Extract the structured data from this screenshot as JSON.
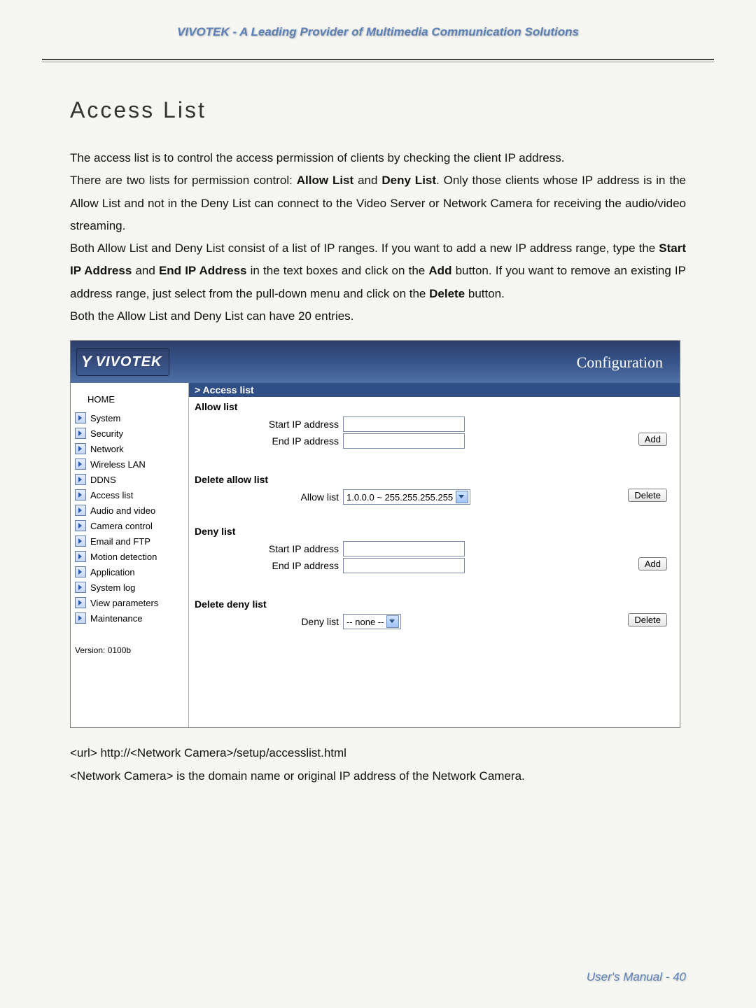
{
  "header": {
    "tagline": "VIVOTEK - A Leading Provider of Multimedia Communication Solutions"
  },
  "title": "Access List",
  "paragraphs": {
    "p1": "The access list is to control the access permission of clients by checking the client IP address.",
    "p2_a": "There are two lists for permission control: ",
    "p2_allow": "Allow List",
    "p2_b": " and ",
    "p2_deny": "Deny List",
    "p2_c": ". Only those clients whose IP address is in the Allow List and not in the Deny List can connect to the Video Server or Network Camera for receiving the audio/video streaming.",
    "p3_a": "Both Allow List and Deny List consist of a list of IP ranges. If you want to add a new IP address range, type the ",
    "p3_start": "Start IP Address",
    "p3_b": " and ",
    "p3_end": "End IP Address",
    "p3_c": " in the text boxes and click on the ",
    "p3_add": "Add",
    "p3_d": " button. If you want to remove an existing IP address range, just select from the pull-down menu and click on the ",
    "p3_del": "Delete",
    "p3_e": " button.",
    "p4": "Both the Allow List and Deny List can have 20 entries."
  },
  "screenshot": {
    "logo_text": "VIVOTEK",
    "config": "Configuration",
    "nav_home": "HOME",
    "nav_items": [
      "System",
      "Security",
      "Network",
      "Wireless LAN",
      "DDNS",
      "Access list",
      "Audio and video",
      "Camera control",
      "Email and FTP",
      "Motion detection",
      "Application",
      "System log",
      "View parameters",
      "Maintenance"
    ],
    "version": "Version: 0100b",
    "crumb": "> Access list",
    "allow_title": "Allow list",
    "start_ip": "Start IP address",
    "end_ip": "End IP address",
    "add": "Add",
    "del_allow_title": "Delete allow list",
    "allow_sel_label": "Allow list",
    "allow_sel_value": "1.0.0.0 ~ 255.255.255.255",
    "delete": "Delete",
    "deny_title": "Deny list",
    "del_deny_title": "Delete deny list",
    "deny_sel_label": "Deny list",
    "deny_sel_value": "-- none --"
  },
  "after": {
    "line1": "<url> http://<Network Camera>/setup/accesslist.html",
    "line2": "<Network Camera> is the domain name or original IP address of the Network Camera."
  },
  "footer": "User's Manual - 40"
}
